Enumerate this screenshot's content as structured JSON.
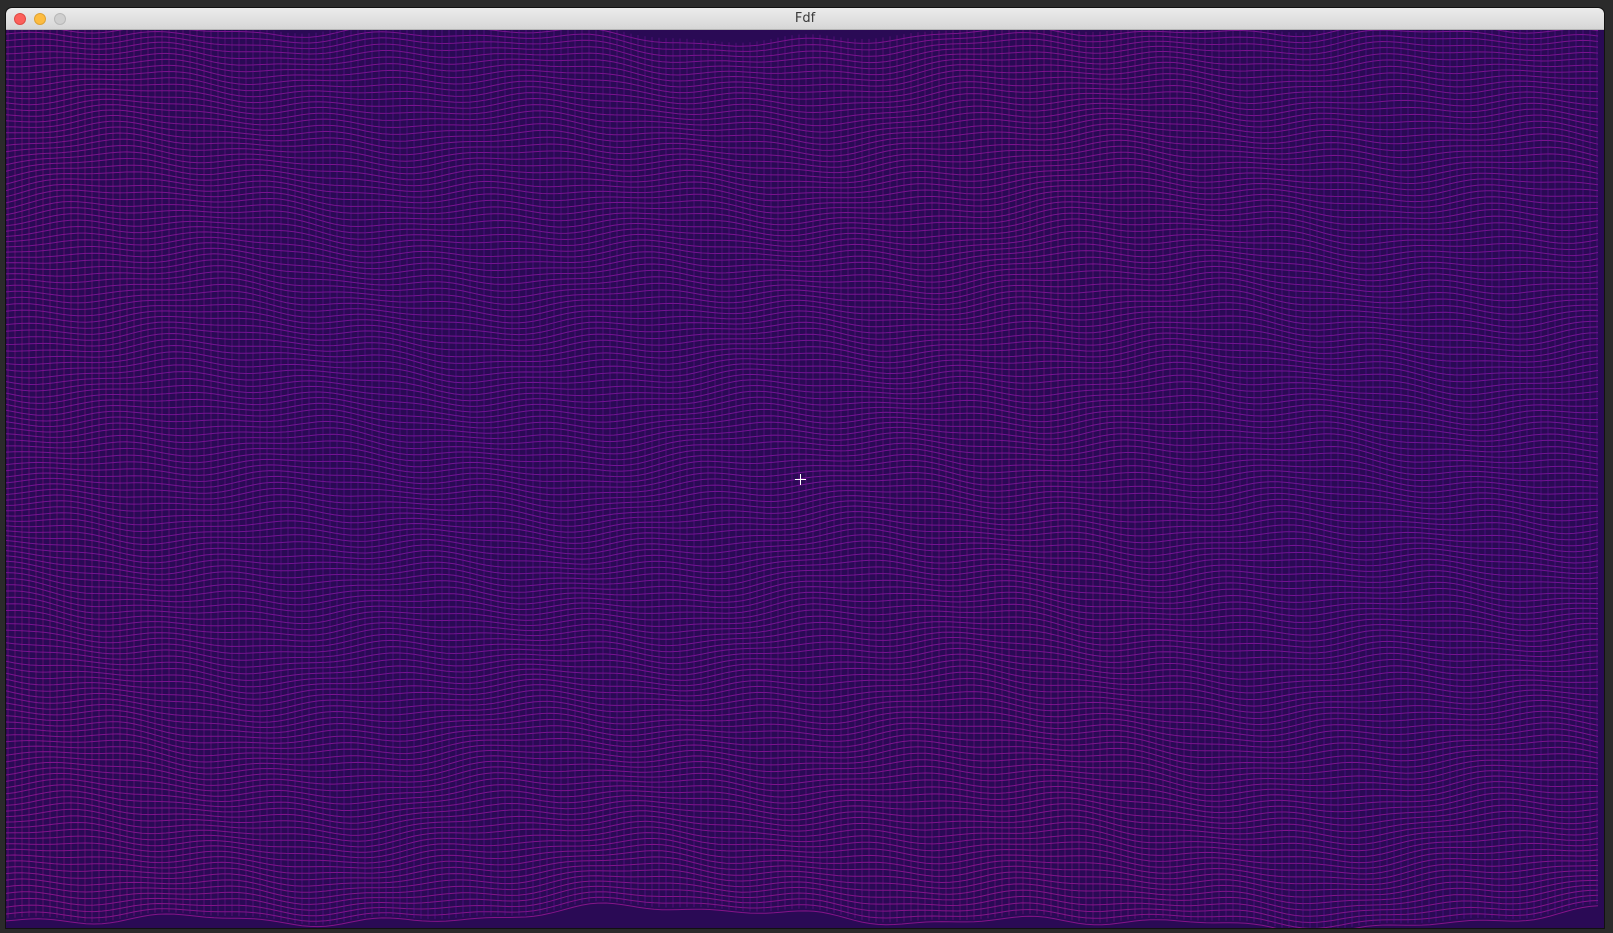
{
  "window": {
    "title": "Fdf",
    "controls": [
      "close",
      "minimize",
      "zoom"
    ]
  },
  "render": {
    "type": "isometric-wireframe-heightmap",
    "color_low": "#3a10c8",
    "color_high": "#ff1a55",
    "background": "#120520",
    "cursor": "crosshair"
  },
  "icons": {
    "close": "close-icon",
    "minimize": "minimize-icon",
    "zoom": "zoom-icon",
    "cursor": "crosshair-cursor-icon"
  }
}
